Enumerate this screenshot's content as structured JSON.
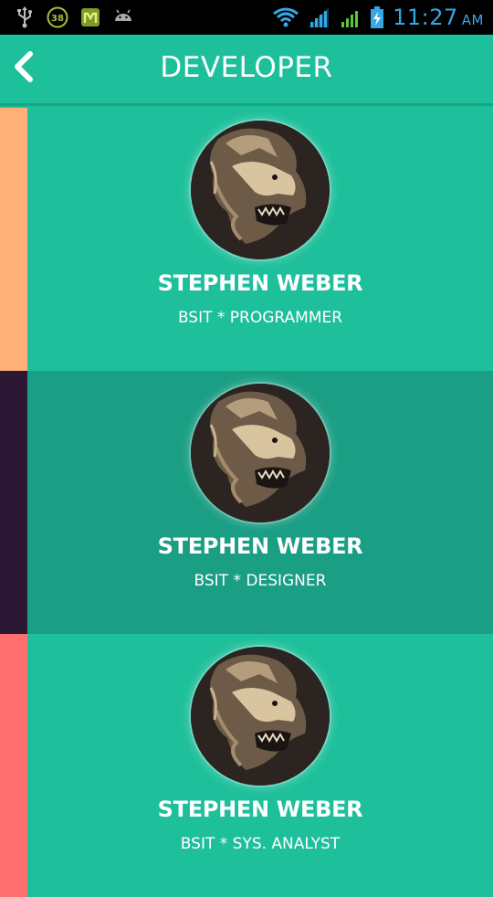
{
  "status_bar": {
    "icons_left": [
      "usb-icon",
      "notification-38-icon",
      "m-app-icon",
      "android-debug-icon"
    ],
    "notification_count": "38",
    "icons_right": [
      "wifi-icon",
      "signal-1-icon",
      "signal-2-icon",
      "battery-charging-icon"
    ],
    "time": "11:27",
    "ampm": "AM"
  },
  "app_bar": {
    "title": "DEVELOPER",
    "back_icon": "chevron-left-icon"
  },
  "developers": [
    {
      "name": "STEPHEN WEBER",
      "role": "BSIT * PROGRAMMER",
      "accent": "#ffaf78",
      "background": "#1ebf9b"
    },
    {
      "name": "STEPHEN WEBER",
      "role": "BSIT * DESIGNER",
      "accent": "#2c1734",
      "background": "#1a9e84"
    },
    {
      "name": "STEPHEN WEBER",
      "role": "BSIT * SYS. ANALYST",
      "accent": "#ff6f6f",
      "background": "#1ebf9b"
    }
  ],
  "colors": {
    "primary": "#1ebf9b",
    "primary_dark": "#1a9e84",
    "status_text": "#35a7e6"
  }
}
